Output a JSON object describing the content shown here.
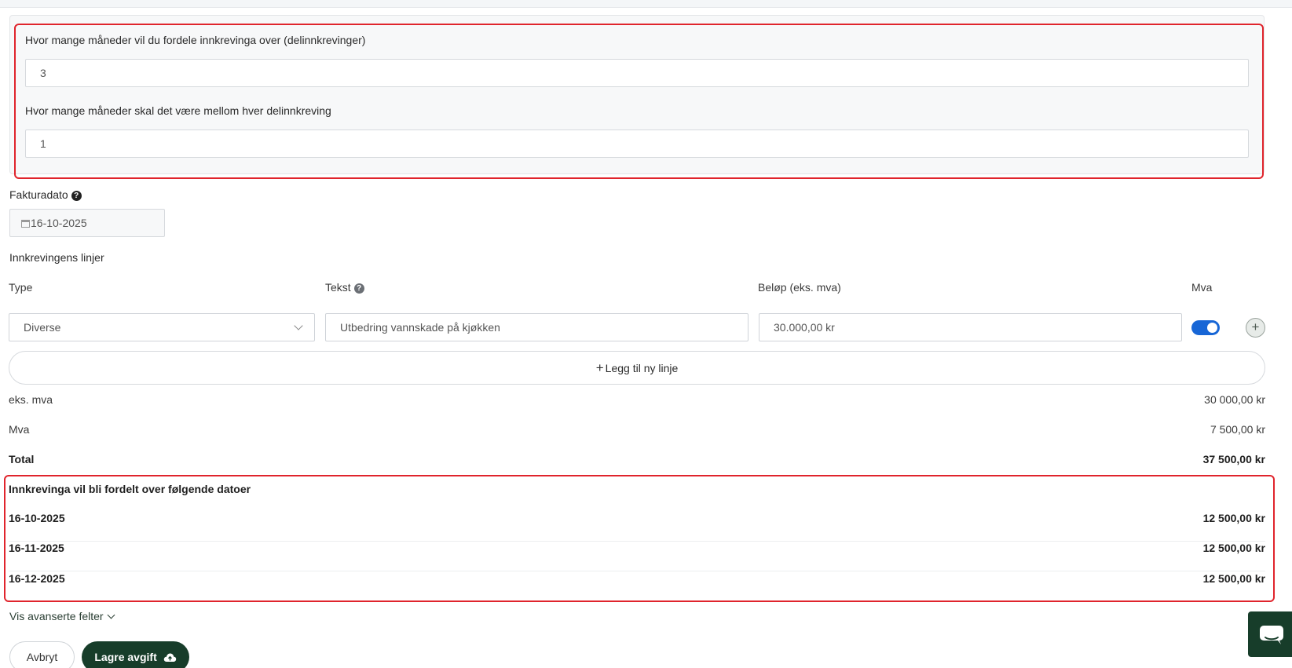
{
  "split": {
    "months_label": "Hvor mange måneder vil du fordele innkrevinga over (delinnkrevinger)",
    "months_value": "3",
    "interval_label": "Hvor mange måneder skal det være mellom hver delinnkreving",
    "interval_value": "1"
  },
  "invoice_date": {
    "label": "Fakturadato",
    "value": "16-10-2025"
  },
  "lines": {
    "section_title": "Innkrevingens linjer",
    "columns": {
      "type": "Type",
      "text": "Tekst",
      "amount": "Beløp (eks. mva)",
      "vat": "Mva"
    },
    "rows": [
      {
        "type": "Diverse",
        "text": "Utbedring vannskade på kjøkken",
        "amount": "30.000,00 kr",
        "vat_enabled": true
      }
    ],
    "add_line_label": "Legg til ny linje"
  },
  "summary": {
    "ex_vat_label": "eks. mva",
    "ex_vat_value": "30 000,00 kr",
    "vat_label": "Mva",
    "vat_value": "7 500,00 kr",
    "total_label": "Total",
    "total_value": "37 500,00 kr"
  },
  "schedule": {
    "title": "Innkrevinga vil bli fordelt over følgende datoer",
    "rows": [
      {
        "date": "16-10-2025",
        "amount": "12 500,00 kr"
      },
      {
        "date": "16-11-2025",
        "amount": "12 500,00 kr"
      },
      {
        "date": "16-12-2025",
        "amount": "12 500,00 kr"
      }
    ]
  },
  "advanced_link": "Vis avanserte felter",
  "actions": {
    "cancel": "Avbryt",
    "save": "Lagre avgift"
  },
  "colors": {
    "accent_blue": "#1766d6",
    "dark_green": "#173d2a",
    "highlight_red": "#e0242c"
  }
}
